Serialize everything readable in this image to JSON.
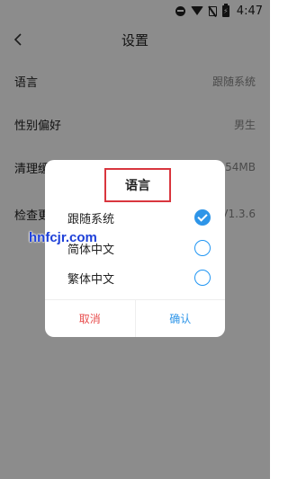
{
  "statusbar": {
    "time": "4:47"
  },
  "header": {
    "title": "设置"
  },
  "settings": [
    {
      "label": "语言",
      "value": "跟随系统"
    },
    {
      "label": "性别偏好",
      "value": "男生"
    },
    {
      "label": "清理缓",
      "value": "7.54MB"
    },
    {
      "label": "检查更",
      "value": "V1.3.6"
    }
  ],
  "dialog": {
    "title": "语言",
    "options": [
      {
        "label": "跟随系统",
        "checked": true
      },
      {
        "label": "简体中文",
        "checked": false
      },
      {
        "label": "繁体中文",
        "checked": false
      }
    ],
    "cancel_label": "取消",
    "ok_label": "确认"
  },
  "watermark": "hnfcjr.com",
  "colors": {
    "accent": "#2e95e8",
    "cancel": "#e84e4e",
    "highlight_box": "#d9363e"
  }
}
